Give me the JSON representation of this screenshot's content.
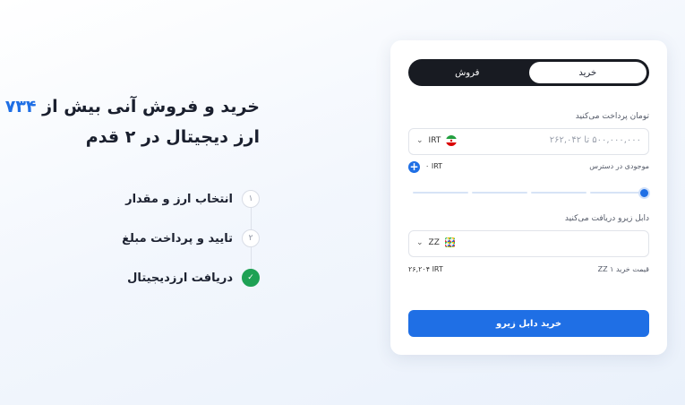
{
  "hero": {
    "title_line1_prefix": "خرید و فروش آنی بیش از ",
    "title_line1_accent": "۷۳۴",
    "title_line2": "ارز دیجیتال در ۲ قدم"
  },
  "steps": [
    {
      "num": "۱",
      "label": "انتخاب ارز و مقدار",
      "done": false
    },
    {
      "num": "۲",
      "label": "تایید و پرداخت مبلغ",
      "done": false
    },
    {
      "num": "✓",
      "label": "دریافت ارزدیجیتال",
      "done": true
    }
  ],
  "card": {
    "tabs": {
      "buy": "خرید",
      "sell": "فروش",
      "active": "buy"
    },
    "pay": {
      "label": "تومان پرداخت می‌کنید",
      "placeholder": "۵۰۰,۰۰۰,۰۰۰ تا ۲۶۲,۰۴۲",
      "currency": "IRT"
    },
    "balance": {
      "label": "موجودی در دسترس",
      "value": "۰ IRT"
    },
    "slider": {
      "value": 1.0
    },
    "receive": {
      "label": "دابل زیرو دریافت می‌کنید",
      "currency": "ZZ"
    },
    "price": {
      "label": "قیمت خرید ۱ ZZ",
      "value": "۲۶,۲۰۴ IRT"
    },
    "submit_label": "خرید دابل زیرو"
  },
  "colors": {
    "accent": "#1f6fe5",
    "success": "#1ea154",
    "dark": "#181b22"
  },
  "icons": {
    "pay_flag": "iran-flag-icon",
    "receive_token": "zz-token-icon",
    "chevron": "chevron-down-icon",
    "plus": "plus-icon",
    "check": "check-icon"
  }
}
